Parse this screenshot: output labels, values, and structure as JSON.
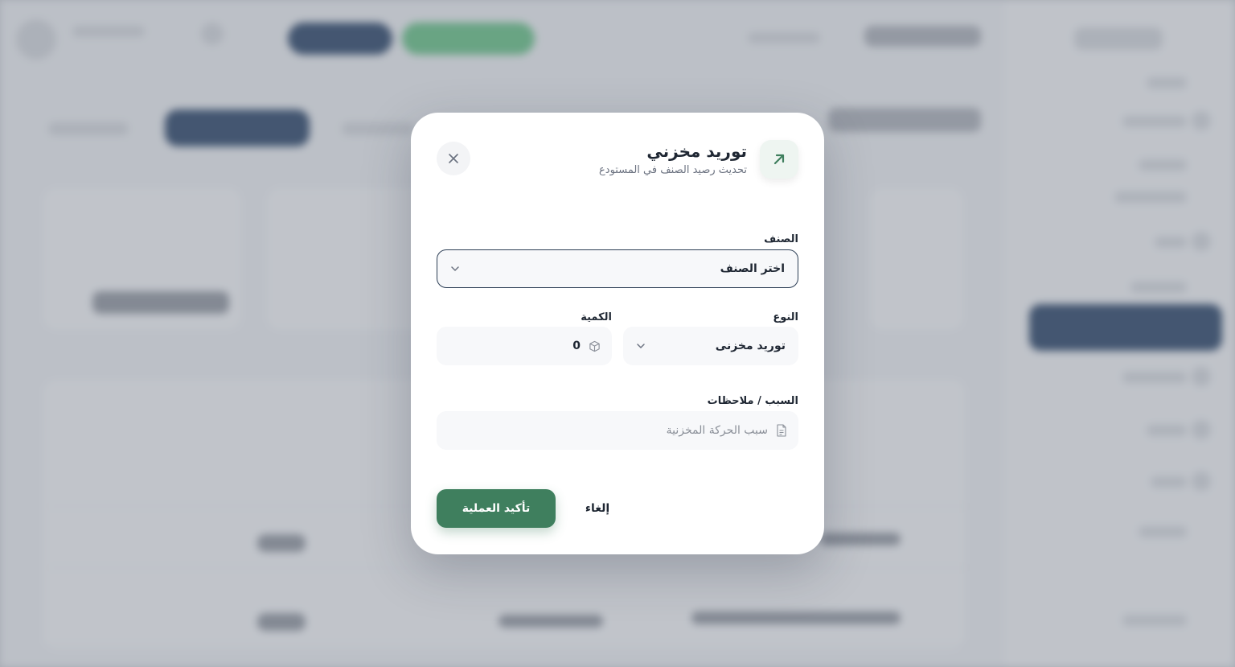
{
  "modal": {
    "title": "توريد مخزني",
    "subtitle": "تحديث رصيد الصنف في المستودع",
    "icon": "arrow-up-right-icon",
    "accent_color": "#3f7f5e",
    "fields": {
      "item": {
        "label": "الصنف",
        "value": "اختر الصنف"
      },
      "type": {
        "label": "النوع",
        "value": "توريد مخزنى"
      },
      "quantity": {
        "label": "الكمية",
        "value": "0"
      },
      "notes": {
        "label": "السبب / ملاحظات",
        "value": "",
        "placeholder": "سبب الحركة المخزنية"
      }
    },
    "actions": {
      "confirm_label": "تأكيد العملية",
      "cancel_label": "إلغاء"
    }
  }
}
